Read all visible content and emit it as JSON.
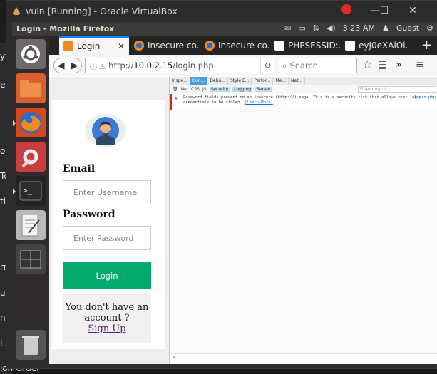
{
  "host": {
    "left_fragments": [
      "yt",
      "ev",
      "on",
      "To",
      "tic",
      "rro",
      "ual",
      "nt",
      "l A"
    ],
    "bottom_text": "ion Order"
  },
  "vbox": {
    "title": "vuln [Running] - Oracle VirtualBox",
    "controls": {
      "minimize": "—",
      "maximize": "☐",
      "close": "✕"
    }
  },
  "topbar": {
    "title": "Login - Mozilla Firefox",
    "time": "3:23 AM",
    "user": "Guest",
    "icons": [
      "mail-icon",
      "battery-icon",
      "network-icon",
      "volume-icon",
      "user-icon",
      "settings-icon"
    ]
  },
  "tabs": [
    {
      "label": "Login",
      "active": true
    },
    {
      "label": "Insecure co...",
      "active": false
    },
    {
      "label": "Insecure co...",
      "active": false
    },
    {
      "label": "PHPSESSID:...",
      "active": false
    },
    {
      "label": "eyJ0eXAiOi...",
      "active": false
    }
  ],
  "nav": {
    "url_scheme": "http://",
    "url_host": "10.0.2.15",
    "url_path": "/login.php",
    "search_placeholder": "Search"
  },
  "login": {
    "username_label": "Email",
    "username_placeholder": "Enter Username",
    "password_label": "Password",
    "password_placeholder": "Enter Password",
    "login_button": "Login",
    "signup_text": "You don't have an account ?",
    "signup_link": "Sign Up"
  },
  "devtools": {
    "tabs": [
      {
        "label": "Inspe...",
        "active": false
      },
      {
        "label": "Con...",
        "active": true
      },
      {
        "label": "Debu...",
        "active": false
      },
      {
        "label": "Style E...",
        "active": false
      },
      {
        "label": "Perfor...",
        "active": false
      },
      {
        "label": "Me...",
        "active": false
      },
      {
        "label": "Net...",
        "active": false
      }
    ],
    "filters": [
      {
        "label": "Net",
        "on": false
      },
      {
        "label": "CSS",
        "on": false
      },
      {
        "label": "JS",
        "on": false
      },
      {
        "label": "Security",
        "on": true
      },
      {
        "label": "Logging",
        "on": true
      },
      {
        "label": "Server",
        "on": true
      }
    ],
    "filter_placeholder": "Filter output",
    "message": "Password fields present on an insecure (http://) page. This is a security risk that allows user login credentials to be stolen.",
    "learn_more": "[Learn More]",
    "message_source": "login.php",
    "input_prompt": "»"
  },
  "colors": {
    "login_button": "#04aa6d",
    "warning": "#d92215",
    "active_tab": "#4c9ed9"
  }
}
